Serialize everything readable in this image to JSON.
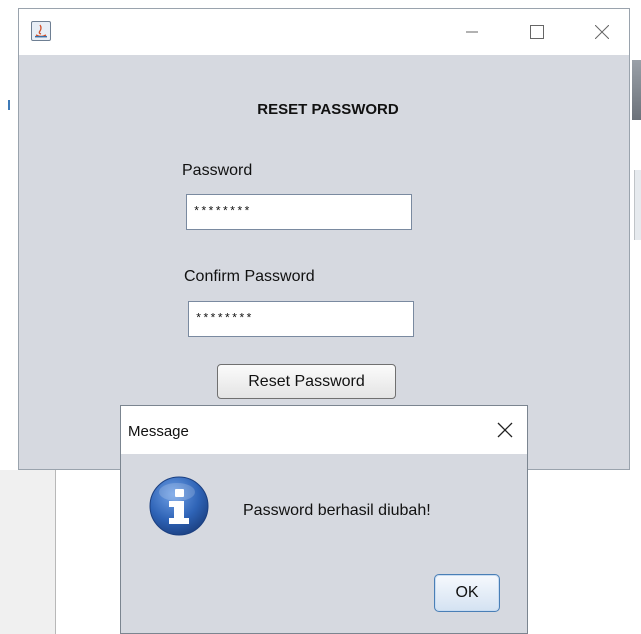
{
  "main_window": {
    "title": "",
    "form_title": "RESET PASSWORD",
    "password_label": "Password",
    "password_value": "********",
    "confirm_label": "Confirm Password",
    "confirm_value": "********",
    "reset_button": "Reset Password"
  },
  "dialog": {
    "title": "Message",
    "message": "Password berhasil diubah!",
    "ok_button": "OK",
    "icon": "info-icon"
  },
  "colors": {
    "window_bg": "#d6d9e0",
    "titlebar_bg": "#ffffff",
    "info_icon_blue": "#2e63b6",
    "ok_border": "#4a7fb6"
  }
}
